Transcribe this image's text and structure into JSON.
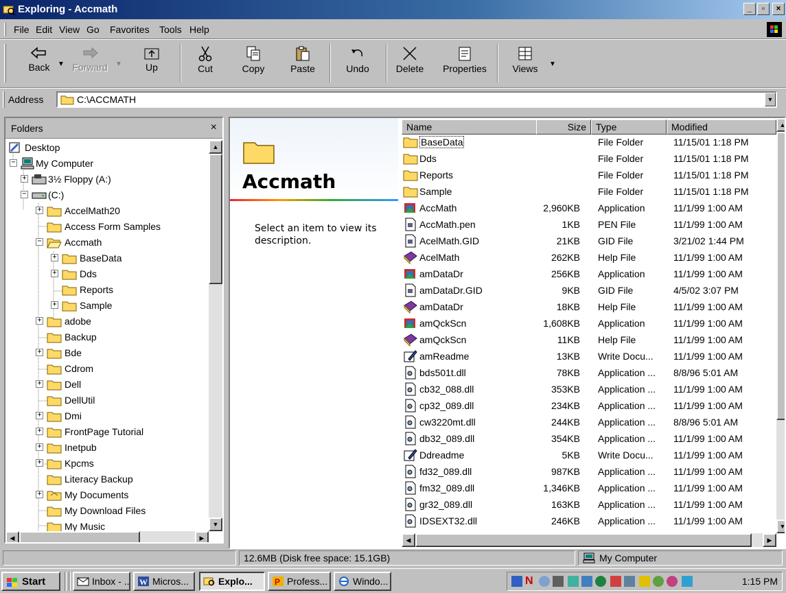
{
  "window": {
    "title": "Exploring - Accmath"
  },
  "menu": {
    "items": [
      {
        "label": "File"
      },
      {
        "label": "Edit"
      },
      {
        "label": "View"
      },
      {
        "label": "Go"
      },
      {
        "label": "Favorites"
      },
      {
        "label": "Tools"
      },
      {
        "label": "Help"
      }
    ]
  },
  "toolbar": {
    "back": "Back",
    "forward": "Forward",
    "up": "Up",
    "cut": "Cut",
    "copy": "Copy",
    "paste": "Paste",
    "undo": "Undo",
    "delete": "Delete",
    "properties": "Properties",
    "views": "Views"
  },
  "address": {
    "label": "Address",
    "value": "C:\\ACCMATH"
  },
  "folders": {
    "title": "Folders",
    "close": "×",
    "tree": [
      {
        "label": "Desktop",
        "icon": "desktop-icon"
      },
      {
        "label": "My Computer",
        "icon": "computer-icon"
      },
      {
        "label": "3½ Floppy (A:)",
        "icon": "floppy-icon"
      },
      {
        "label": "(C:)",
        "icon": "drive-icon"
      },
      {
        "label": "AccelMath20",
        "icon": "folder-icon"
      },
      {
        "label": "Access Form Samples",
        "icon": "folder-icon"
      },
      {
        "label": "Accmath",
        "icon": "open-folder-icon"
      },
      {
        "label": "BaseData",
        "icon": "folder-icon"
      },
      {
        "label": "Dds",
        "icon": "folder-icon"
      },
      {
        "label": "Reports",
        "icon": "folder-icon"
      },
      {
        "label": "Sample",
        "icon": "folder-icon"
      },
      {
        "label": "adobe",
        "icon": "folder-icon"
      },
      {
        "label": "Backup",
        "icon": "folder-icon"
      },
      {
        "label": "Bde",
        "icon": "folder-icon"
      },
      {
        "label": "Cdrom",
        "icon": "folder-icon"
      },
      {
        "label": "Dell",
        "icon": "folder-icon"
      },
      {
        "label": "DellUtil",
        "icon": "folder-icon"
      },
      {
        "label": "Dmi",
        "icon": "folder-icon"
      },
      {
        "label": "FrontPage Tutorial",
        "icon": "folder-icon"
      },
      {
        "label": "Inetpub",
        "icon": "folder-icon"
      },
      {
        "label": "Kpcms",
        "icon": "folder-icon"
      },
      {
        "label": "Literacy Backup",
        "icon": "folder-icon"
      },
      {
        "label": "My Documents",
        "icon": "folder-icon"
      },
      {
        "label": "My Download Files",
        "icon": "folder-icon"
      },
      {
        "label": "My Music",
        "icon": "folder-icon"
      }
    ]
  },
  "webview": {
    "title": "Accmath",
    "description": "Select an item to view its description."
  },
  "list": {
    "columns": {
      "name": "Name",
      "size": "Size",
      "type": "Type",
      "modified": "Modified"
    },
    "rows": [
      {
        "name": "BaseData",
        "size": "",
        "type": "File Folder",
        "modified": "11/15/01 1:18 PM",
        "icon": "folder-icon"
      },
      {
        "name": "Dds",
        "size": "",
        "type": "File Folder",
        "modified": "11/15/01 1:18 PM",
        "icon": "folder-icon"
      },
      {
        "name": "Reports",
        "size": "",
        "type": "File Folder",
        "modified": "11/15/01 1:18 PM",
        "icon": "folder-icon"
      },
      {
        "name": "Sample",
        "size": "",
        "type": "File Folder",
        "modified": "11/15/01 1:18 PM",
        "icon": "folder-icon"
      },
      {
        "name": "AccMath",
        "size": "2,960KB",
        "type": "Application",
        "modified": "11/1/99 1:00 AM",
        "icon": "app-icon"
      },
      {
        "name": "AccMath.pen",
        "size": "1KB",
        "type": "PEN File",
        "modified": "11/1/99 1:00 AM",
        "icon": "file-icon"
      },
      {
        "name": "AcelMath.GID",
        "size": "21KB",
        "type": "GID File",
        "modified": "3/21/02 1:44 PM",
        "icon": "file-icon"
      },
      {
        "name": "AcelMath",
        "size": "262KB",
        "type": "Help File",
        "modified": "11/1/99 1:00 AM",
        "icon": "help-book-icon"
      },
      {
        "name": "amDataDr",
        "size": "256KB",
        "type": "Application",
        "modified": "11/1/99 1:00 AM",
        "icon": "app-icon"
      },
      {
        "name": "amDataDr.GID",
        "size": "9KB",
        "type": "GID File",
        "modified": "4/5/02 3:07 PM",
        "icon": "file-icon"
      },
      {
        "name": "amDataDr",
        "size": "18KB",
        "type": "Help File",
        "modified": "11/1/99 1:00 AM",
        "icon": "help-book-icon"
      },
      {
        "name": "amQckScn",
        "size": "1,608KB",
        "type": "Application",
        "modified": "11/1/99 1:00 AM",
        "icon": "app-icon"
      },
      {
        "name": "amQckScn",
        "size": "11KB",
        "type": "Help File",
        "modified": "11/1/99 1:00 AM",
        "icon": "help-book-icon"
      },
      {
        "name": "amReadme",
        "size": "13KB",
        "type": "Write Docu...",
        "modified": "11/1/99 1:00 AM",
        "icon": "write-doc-icon"
      },
      {
        "name": "bds501t.dll",
        "size": "78KB",
        "type": "Application ...",
        "modified": "8/8/96 5:01 AM",
        "icon": "dll-icon"
      },
      {
        "name": "cb32_088.dll",
        "size": "353KB",
        "type": "Application ...",
        "modified": "11/1/99 1:00 AM",
        "icon": "dll-icon"
      },
      {
        "name": "cp32_089.dll",
        "size": "234KB",
        "type": "Application ...",
        "modified": "11/1/99 1:00 AM",
        "icon": "dll-icon"
      },
      {
        "name": "cw3220mt.dll",
        "size": "244KB",
        "type": "Application ...",
        "modified": "8/8/96 5:01 AM",
        "icon": "dll-icon"
      },
      {
        "name": "db32_089.dll",
        "size": "354KB",
        "type": "Application ...",
        "modified": "11/1/99 1:00 AM",
        "icon": "dll-icon"
      },
      {
        "name": "Ddreadme",
        "size": "5KB",
        "type": "Write Docu...",
        "modified": "11/1/99 1:00 AM",
        "icon": "write-doc-icon"
      },
      {
        "name": "fd32_089.dll",
        "size": "987KB",
        "type": "Application ...",
        "modified": "11/1/99 1:00 AM",
        "icon": "dll-icon"
      },
      {
        "name": "fm32_089.dll",
        "size": "1,346KB",
        "type": "Application ...",
        "modified": "11/1/99 1:00 AM",
        "icon": "dll-icon"
      },
      {
        "name": "gr32_089.dll",
        "size": "163KB",
        "type": "Application ...",
        "modified": "11/1/99 1:00 AM",
        "icon": "dll-icon"
      },
      {
        "name": "IDSEXT32.dll",
        "size": "246KB",
        "type": "Application ...",
        "modified": "11/1/99 1:00 AM",
        "icon": "dll-icon"
      }
    ]
  },
  "status": {
    "left": "",
    "disk": "12.6MB (Disk free space: 15.1GB)",
    "location": "My Computer"
  },
  "taskbar": {
    "start": "Start",
    "tasks": [
      {
        "label": "Inbox - ..."
      },
      {
        "label": "Micros..."
      },
      {
        "label": "Explo..."
      },
      {
        "label": "Profess..."
      },
      {
        "label": "Windo..."
      }
    ],
    "clock": "1:15 PM"
  },
  "colors": {
    "title_bar": "#0a246a",
    "face": "#c0c0c0",
    "folder": "#ffd966"
  }
}
